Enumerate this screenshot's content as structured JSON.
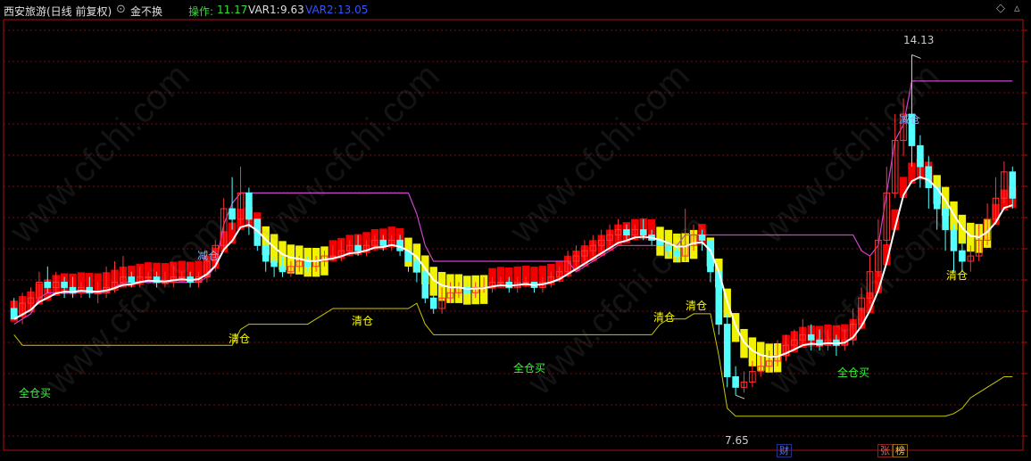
{
  "header": {
    "title": "西安旅游(日线 前复权)",
    "indicator_name": "金不换",
    "op_label": "操作:",
    "op_value": "11.17",
    "var1_label": "VAR1:",
    "var1_value": "9.63",
    "var2_label": "VAR2:",
    "var2_value": "13.05"
  },
  "colors": {
    "background": "#000000",
    "frame": "#b01010",
    "grid": "#7a0a0a",
    "candle_up": "#ff3333",
    "candle_down": "#54ffff",
    "band_red": "#ff0000",
    "band_yellow": "#ffff00",
    "white_line": "#ffffff",
    "magenta_line": "#cc44cc",
    "yellow_line": "#c8c800",
    "label_reduce": "#8ab4ff",
    "label_clear": "#ffff00",
    "label_buy": "#33ff33",
    "op_color": "#33dd33",
    "var1_color": "#dddddd",
    "var2_color": "#3355ff"
  },
  "watermark": "www.cfchi.com",
  "annotations": {
    "high_label": "14.13",
    "low_label": "7.65",
    "reduce": "减仓",
    "clear": "清仓",
    "buy": "全仓买"
  },
  "badges": {
    "cai": "财",
    "zhang": "张",
    "bang": "榜"
  },
  "chart_data": {
    "type": "candlestick",
    "title": "西安旅游(日线 前复权) 金不换",
    "price_range": [
      6.6,
      14.8
    ],
    "high_marked": 14.13,
    "low_marked": 7.65,
    "bars": [
      [
        9.3,
        9.1,
        9.5,
        9.2
      ],
      [
        9.2,
        9.4,
        9.6,
        9.0
      ],
      [
        9.4,
        9.5,
        9.7,
        9.3
      ],
      [
        9.5,
        9.8,
        10.0,
        9.4
      ],
      [
        9.8,
        9.7,
        10.1,
        9.6
      ],
      [
        9.7,
        9.8,
        10.0,
        9.6
      ],
      [
        9.8,
        9.7,
        9.9,
        9.5
      ],
      [
        9.7,
        9.6,
        9.9,
        9.5
      ],
      [
        9.6,
        9.7,
        9.8,
        9.5
      ],
      [
        9.7,
        9.6,
        9.9,
        9.5
      ],
      [
        9.6,
        9.6,
        9.8,
        9.4
      ],
      [
        9.6,
        9.7,
        10.1,
        9.5
      ],
      [
        9.7,
        9.8,
        10.2,
        9.6
      ],
      [
        9.8,
        9.9,
        10.3,
        9.7
      ],
      [
        9.9,
        9.8,
        10.0,
        9.7
      ],
      [
        9.8,
        9.9,
        10.1,
        9.7
      ],
      [
        9.9,
        9.9,
        10.0,
        9.8
      ],
      [
        9.9,
        9.8,
        10.0,
        9.7
      ],
      [
        9.8,
        9.8,
        10.0,
        9.7
      ],
      [
        9.8,
        9.9,
        10.1,
        9.7
      ],
      [
        9.9,
        9.9,
        10.0,
        9.8
      ],
      [
        9.9,
        9.8,
        10.0,
        9.7
      ],
      [
        9.8,
        9.9,
        10.0,
        9.7
      ],
      [
        9.9,
        10.2,
        10.4,
        9.8
      ],
      [
        10.2,
        10.5,
        10.6,
        10.0
      ],
      [
        10.5,
        11.2,
        11.4,
        10.4
      ],
      [
        11.2,
        11.0,
        11.8,
        10.8
      ],
      [
        11.0,
        11.5,
        12.0,
        10.9
      ],
      [
        11.5,
        11.0,
        11.6,
        10.7
      ],
      [
        11.0,
        10.5,
        11.0,
        10.4
      ],
      [
        10.5,
        10.2,
        10.6,
        10.0
      ],
      [
        10.2,
        10.1,
        10.3,
        9.9
      ],
      [
        10.1,
        10.0,
        10.3,
        9.9
      ],
      [
        10.0,
        10.1,
        10.2,
        9.9
      ],
      [
        10.1,
        10.2,
        10.3,
        10.0
      ],
      [
        10.2,
        10.1,
        10.3,
        10.0
      ],
      [
        10.1,
        10.2,
        10.3,
        10.0
      ],
      [
        10.2,
        10.3,
        10.4,
        10.1
      ],
      [
        10.3,
        10.3,
        10.5,
        10.2
      ],
      [
        10.3,
        10.4,
        10.6,
        10.2
      ],
      [
        10.4,
        10.5,
        10.6,
        10.3
      ],
      [
        10.5,
        10.4,
        10.7,
        10.3
      ],
      [
        10.4,
        10.5,
        10.6,
        10.3
      ],
      [
        10.5,
        10.6,
        10.7,
        10.4
      ],
      [
        10.6,
        10.5,
        10.7,
        10.4
      ],
      [
        10.5,
        10.6,
        10.7,
        10.4
      ],
      [
        10.6,
        10.4,
        10.7,
        10.3
      ],
      [
        10.4,
        10.2,
        10.5,
        10.0
      ],
      [
        10.2,
        10.0,
        10.3,
        9.8
      ],
      [
        10.0,
        9.5,
        10.0,
        9.4
      ],
      [
        9.5,
        9.3,
        9.6,
        9.2
      ],
      [
        9.3,
        9.5,
        9.7,
        9.2
      ],
      [
        9.5,
        9.6,
        9.8,
        9.4
      ],
      [
        9.6,
        9.7,
        9.8,
        9.5
      ],
      [
        9.7,
        9.6,
        9.8,
        9.5
      ],
      [
        9.6,
        9.7,
        9.8,
        9.5
      ],
      [
        9.7,
        9.7,
        9.9,
        9.6
      ],
      [
        9.7,
        9.8,
        9.9,
        9.6
      ],
      [
        9.8,
        9.8,
        9.9,
        9.7
      ],
      [
        9.8,
        9.7,
        9.9,
        9.6
      ],
      [
        9.7,
        9.8,
        9.9,
        9.6
      ],
      [
        9.8,
        9.8,
        9.9,
        9.7
      ],
      [
        9.8,
        9.7,
        9.8,
        9.6
      ],
      [
        9.7,
        9.8,
        9.9,
        9.6
      ],
      [
        9.8,
        9.9,
        10.0,
        9.7
      ],
      [
        9.9,
        10.0,
        10.1,
        9.8
      ],
      [
        10.0,
        10.2,
        10.4,
        9.9
      ],
      [
        10.2,
        10.3,
        10.5,
        10.1
      ],
      [
        10.3,
        10.4,
        10.6,
        10.2
      ],
      [
        10.4,
        10.5,
        10.7,
        10.3
      ],
      [
        10.5,
        10.6,
        10.8,
        10.4
      ],
      [
        10.6,
        10.7,
        10.9,
        10.5
      ],
      [
        10.7,
        10.8,
        11.0,
        10.6
      ],
      [
        10.8,
        10.7,
        10.9,
        10.6
      ],
      [
        10.7,
        10.8,
        10.9,
        10.6
      ],
      [
        10.8,
        10.7,
        11.0,
        10.6
      ],
      [
        10.7,
        10.6,
        10.8,
        10.5
      ],
      [
        10.6,
        10.5,
        10.7,
        10.4
      ],
      [
        10.5,
        10.4,
        10.6,
        10.3
      ],
      [
        10.4,
        10.3,
        10.5,
        10.2
      ],
      [
        10.3,
        10.5,
        11.2,
        10.2
      ],
      [
        10.5,
        10.7,
        10.9,
        10.4
      ],
      [
        10.7,
        10.6,
        10.8,
        10.4
      ],
      [
        10.6,
        10.0,
        10.6,
        9.8
      ],
      [
        10.0,
        9.0,
        10.1,
        8.8
      ],
      [
        9.0,
        8.0,
        9.2,
        7.8
      ],
      [
        8.0,
        7.8,
        8.2,
        7.65
      ],
      [
        7.8,
        7.9,
        8.1,
        7.7
      ],
      [
        7.9,
        8.1,
        8.3,
        7.8
      ],
      [
        8.1,
        8.2,
        8.4,
        8.0
      ],
      [
        8.2,
        8.3,
        8.5,
        8.1
      ],
      [
        8.3,
        8.4,
        8.7,
        8.2
      ],
      [
        8.4,
        8.6,
        8.8,
        8.3
      ],
      [
        8.6,
        8.7,
        8.9,
        8.5
      ],
      [
        8.7,
        8.8,
        9.1,
        8.6
      ],
      [
        8.8,
        8.7,
        9.0,
        8.5
      ],
      [
        8.7,
        8.6,
        8.9,
        8.5
      ],
      [
        8.6,
        8.7,
        8.9,
        8.5
      ],
      [
        8.7,
        8.6,
        8.8,
        8.4
      ],
      [
        8.6,
        8.7,
        8.9,
        8.5
      ],
      [
        8.7,
        9.0,
        9.3,
        8.6
      ],
      [
        9.0,
        9.5,
        9.7,
        8.9
      ],
      [
        9.5,
        10.0,
        10.3,
        9.4
      ],
      [
        10.0,
        10.6,
        11.0,
        9.9
      ],
      [
        10.6,
        11.5,
        12.0,
        10.5
      ],
      [
        11.5,
        12.5,
        13.0,
        11.4
      ],
      [
        12.5,
        13.0,
        13.3,
        12.2
      ],
      [
        13.0,
        12.4,
        14.13,
        12.0
      ],
      [
        12.4,
        12.0,
        12.6,
        11.6
      ],
      [
        12.0,
        11.6,
        12.2,
        11.2
      ],
      [
        11.6,
        11.2,
        11.8,
        10.8
      ],
      [
        11.2,
        10.8,
        11.3,
        10.4
      ],
      [
        10.8,
        10.4,
        10.9,
        10.0
      ],
      [
        10.4,
        10.2,
        10.6,
        10.0
      ],
      [
        10.2,
        10.3,
        10.5,
        10.0
      ],
      [
        10.3,
        10.6,
        10.9,
        10.2
      ],
      [
        10.6,
        11.0,
        11.3,
        10.5
      ],
      [
        11.0,
        11.4,
        11.8,
        10.9
      ],
      [
        11.4,
        11.9,
        12.1,
        11.3
      ],
      [
        11.9,
        11.4,
        12.0,
        11.2
      ]
    ]
  }
}
